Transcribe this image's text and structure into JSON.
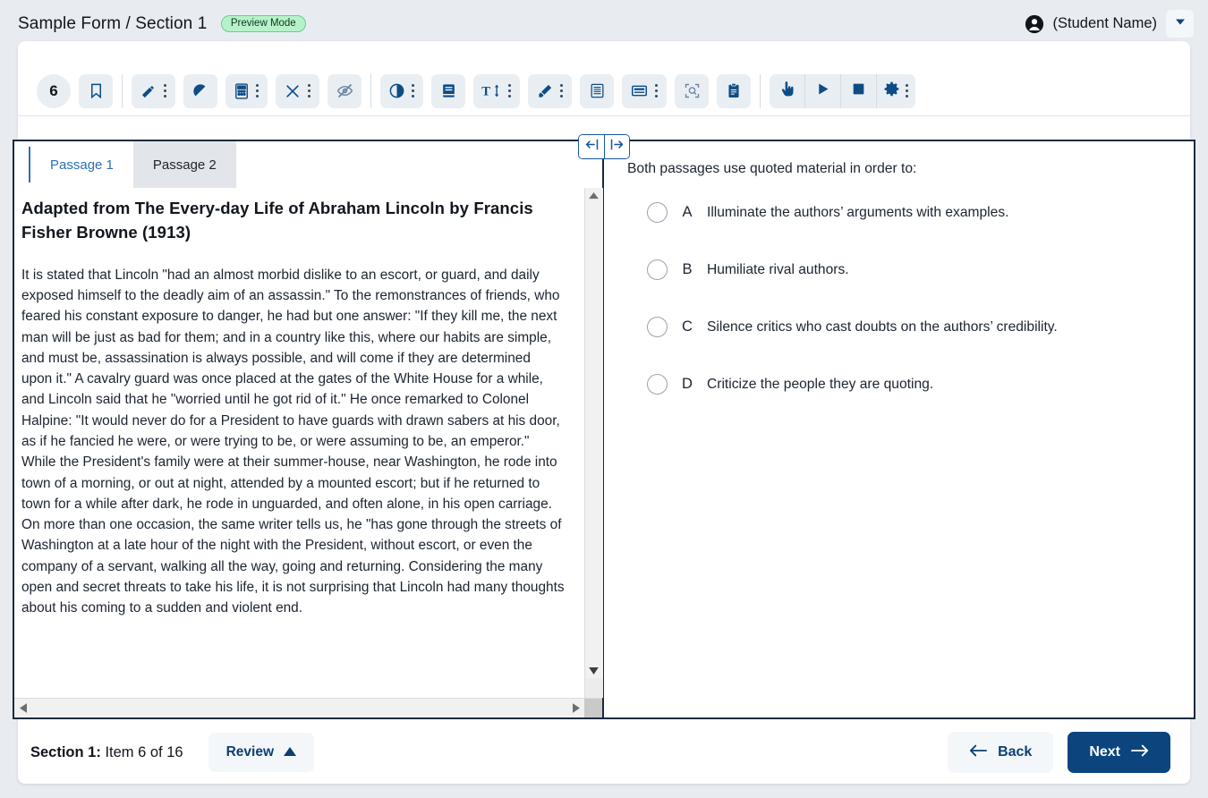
{
  "header": {
    "title": "Sample Form / Section 1",
    "preview_badge": "Preview Mode",
    "user_name": "(Student Name)",
    "user_icon": "account-circle-icon",
    "caret_icon": "chevron-down-icon"
  },
  "toolbar": {
    "item_number": "6",
    "bookmark_icon": "bookmark-icon",
    "tools": [
      {
        "icon": "ruler-icon",
        "name": "ruler-tool",
        "kebab": true
      },
      {
        "icon": "protractor-icon",
        "name": "protractor-tool",
        "kebab": false
      },
      {
        "icon": "calculator-icon",
        "name": "calculator-tool",
        "kebab": true
      },
      {
        "icon": "cross-off-icon",
        "name": "answer-eliminator-tool",
        "kebab": true
      },
      {
        "icon": "eye-slash-icon",
        "name": "masking-tool",
        "kebab": false
      },
      {
        "icon": "contrast-icon",
        "name": "contrast-tool",
        "kebab": true
      },
      {
        "icon": "book-icon",
        "name": "reference-book-tool",
        "kebab": false
      },
      {
        "icon": "text-size-icon",
        "name": "text-size-tool",
        "kebab": true
      },
      {
        "icon": "highlighter-icon",
        "name": "highlighter-tool",
        "kebab": true
      },
      {
        "icon": "lines-icon",
        "name": "line-reader-tool",
        "kebab": false
      },
      {
        "icon": "magnifier-window-icon",
        "name": "zoom-window-tool",
        "kebab": true
      },
      {
        "icon": "magnify-select-icon",
        "name": "magnify-region-tool",
        "kebab": false
      },
      {
        "icon": "clipboard-icon",
        "name": "notepad-tool",
        "kebab": false
      }
    ],
    "media": [
      {
        "icon": "hand-pointer-icon",
        "name": "pointer-tool",
        "kebab": false
      },
      {
        "icon": "play-icon",
        "name": "play-audio-button",
        "kebab": false
      },
      {
        "icon": "stop-icon",
        "name": "stop-audio-button",
        "kebab": false
      },
      {
        "icon": "gear-icon",
        "name": "audio-settings-button",
        "kebab": true
      }
    ]
  },
  "splitter": {
    "collapse_left_icon": "arrow-to-left-bar-icon",
    "collapse_right_icon": "arrow-to-right-bar-icon"
  },
  "passage_panel": {
    "tabs": [
      {
        "label": "Passage 1",
        "active": true
      },
      {
        "label": "Passage 2",
        "active": false
      }
    ],
    "heading": "Adapted from The Every-day Life of Abraham Lincoln by Francis Fisher Browne (1913)",
    "body": "It is stated that Lincoln \"had an almost morbid dislike to an escort, or guard, and daily exposed himself to the deadly aim of an assassin.\" To the remonstrances of friends, who feared his constant exposure to danger, he had but one answer: \"If they kill me, the next man will be just as bad for them; and in a country like this, where our habits are simple, and must be, assassination is always possible, and will come if they are determined upon it.\" A cavalry guard was once placed at the gates of the White House for a while, and Lincoln said that he \"worried until he got rid of it.\" He once remarked to Colonel Halpine: \"It would never do for a President to have guards with drawn sabers at his door, as if he fancied he were, or were trying to be, or were assuming to be, an emperor.\" While the President's family were at their summer-house, near Washington, he rode into town of a morning, or out at night, attended by a mounted escort; but if he returned to town for a while after dark, he rode in unguarded, and often alone, in his open carriage. On more than one occasion, the same writer tells us, he \"has gone through the streets of Washington at a late hour of the night with the President, without escort, or even the company of a servant, walking all the way, going and returning. Considering the many open and secret threats to take his life, it is not surprising that Lincoln had many thoughts about his coming to a sudden and violent end."
  },
  "question": {
    "stem": "Both passages use quoted material in order to:",
    "choices": [
      {
        "letter": "A",
        "text": "Illuminate the authors’ arguments with examples.",
        "selected": false
      },
      {
        "letter": "B",
        "text": "Humiliate rival authors.",
        "selected": false
      },
      {
        "letter": "C",
        "text": "Silence critics who cast doubts on the authors’ credibility.",
        "selected": false
      },
      {
        "letter": "D",
        "text": "Criticize the people they are quoting.",
        "selected": false
      }
    ]
  },
  "footer": {
    "section_label": "Section 1:",
    "item_progress": " Item 6 of 16",
    "review_label": "Review",
    "review_icon": "triangle-up-icon",
    "back_label": "Back",
    "back_icon": "arrow-left-icon",
    "next_label": "Next",
    "next_icon": "arrow-right-icon"
  },
  "colors": {
    "page_bg": "#e8ecf1",
    "card_bg": "#ffffff",
    "accent_blue": "#0c457e",
    "tool_blue": "#0d4d86",
    "badge_green": "#b6f2c8",
    "pane_border": "#1b2a3d"
  }
}
